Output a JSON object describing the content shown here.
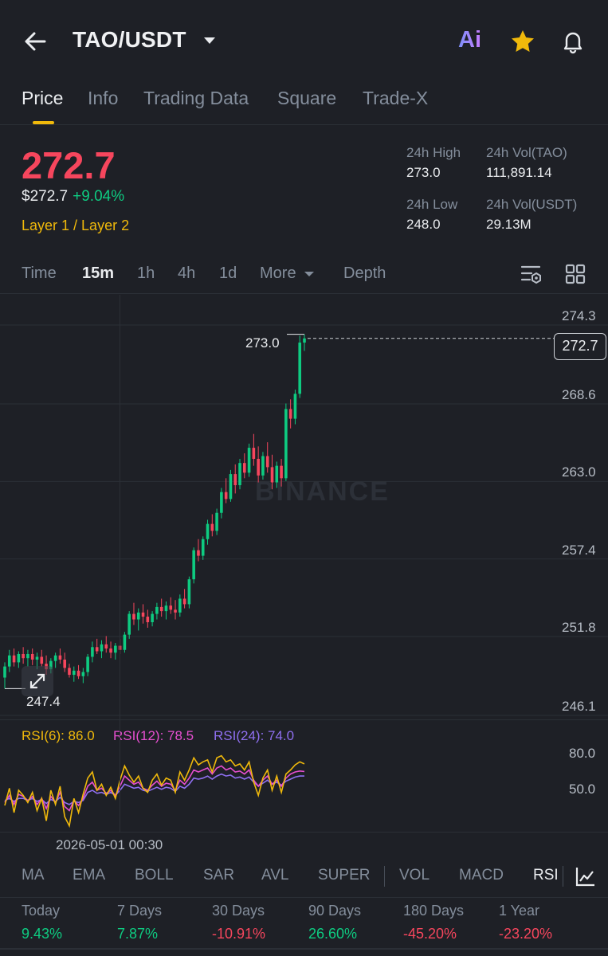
{
  "header": {
    "pair": "TAO/USDT",
    "ai_label": "Ai"
  },
  "tabs": [
    "Price",
    "Info",
    "Trading Data",
    "Square",
    "Trade-X"
  ],
  "price": {
    "last": "272.7",
    "usd": "$272.7",
    "change": "+9.04%",
    "tag": "Layer 1 / Layer 2"
  },
  "stats": {
    "high_label": "24h High",
    "high": "273.0",
    "vol_tao_label": "24h Vol(TAO)",
    "vol_tao": "111,891.14",
    "low_label": "24h Low",
    "low": "248.0",
    "vol_usdt_label": "24h Vol(USDT)",
    "vol_usdt": "29.13M"
  },
  "timeframes": {
    "time": "Time",
    "m15": "15m",
    "h1": "1h",
    "h4": "4h",
    "d1": "1d",
    "more": "More",
    "depth": "Depth"
  },
  "chart": {
    "watermark": "BINANCE",
    "price_axis": [
      "274.3",
      "268.6",
      "263.0",
      "257.4",
      "251.8",
      "246.1"
    ],
    "current_price_label": "272.7",
    "high_marker": "273.0",
    "low_marker": "247.4",
    "time_label": "2026-05-01 00:30",
    "colors": {
      "up": "#0ecb81",
      "down": "#f6465d"
    }
  },
  "rsi": {
    "rsi6": "RSI(6): 86.0",
    "rsi12": "RSI(12): 78.5",
    "rsi24": "RSI(24): 74.0",
    "axis": [
      "80.0",
      "50.0"
    ],
    "colors": {
      "rsi6": "#f0b90b",
      "rsi12": "#e64fd0",
      "rsi24": "#8f6ff0"
    }
  },
  "indicators": [
    "MA",
    "EMA",
    "BOLL",
    "SAR",
    "AVL",
    "SUPER",
    "VOL",
    "MACD",
    "RSI"
  ],
  "performance": [
    {
      "label": "Today",
      "value": "9.43%"
    },
    {
      "label": "7 Days",
      "value": "7.87%"
    },
    {
      "label": "30 Days",
      "value": "-10.91%"
    },
    {
      "label": "90 Days",
      "value": "26.60%"
    },
    {
      "label": "180 Days",
      "value": "-45.20%"
    },
    {
      "label": "1 Year",
      "value": "-23.20%"
    }
  ],
  "chart_data": {
    "type": "candlestick",
    "ylim": [
      246.1,
      274.3
    ],
    "y_ticks": [
      274.3,
      268.6,
      263.0,
      257.4,
      251.8,
      246.1
    ],
    "candles": [
      [
        248.2,
        249.3,
        247.4,
        249.0
      ],
      [
        249.0,
        250.2,
        248.6,
        249.8
      ],
      [
        249.8,
        250.3,
        249.0,
        249.3
      ],
      [
        249.3,
        250.1,
        248.9,
        249.9
      ],
      [
        249.9,
        250.4,
        249.2,
        249.6
      ],
      [
        249.6,
        250.2,
        249.0,
        249.9
      ],
      [
        249.9,
        250.3,
        249.1,
        249.5
      ],
      [
        249.5,
        250.0,
        248.8,
        249.7
      ],
      [
        249.7,
        250.2,
        249.0,
        249.2
      ],
      [
        249.2,
        249.8,
        248.4,
        248.8
      ],
      [
        248.8,
        249.6,
        248.5,
        249.4
      ],
      [
        249.4,
        250.0,
        248.9,
        249.8
      ],
      [
        249.8,
        250.3,
        249.2,
        249.5
      ],
      [
        249.5,
        250.0,
        248.6,
        248.9
      ],
      [
        248.9,
        249.2,
        248.2,
        248.4
      ],
      [
        248.4,
        249.0,
        247.9,
        248.7
      ],
      [
        248.7,
        249.1,
        248.1,
        248.3
      ],
      [
        248.3,
        248.9,
        247.8,
        248.6
      ],
      [
        248.6,
        249.9,
        248.3,
        249.7
      ],
      [
        249.7,
        250.8,
        249.3,
        250.4
      ],
      [
        250.4,
        251.0,
        249.9,
        250.1
      ],
      [
        250.1,
        250.9,
        249.6,
        250.6
      ],
      [
        250.6,
        251.2,
        250.0,
        250.3
      ],
      [
        250.3,
        250.8,
        249.6,
        250.0
      ],
      [
        250.0,
        250.7,
        249.5,
        250.5
      ],
      [
        250.5,
        251.0,
        249.9,
        250.2
      ],
      [
        250.2,
        251.5,
        250.0,
        251.3
      ],
      [
        251.3,
        253.0,
        251.0,
        252.8
      ],
      [
        252.8,
        253.6,
        252.0,
        252.4
      ],
      [
        252.4,
        253.2,
        251.6,
        252.9
      ],
      [
        252.9,
        253.5,
        252.1,
        252.6
      ],
      [
        252.6,
        253.1,
        251.8,
        252.2
      ],
      [
        252.2,
        253.0,
        251.9,
        252.8
      ],
      [
        252.8,
        253.6,
        252.4,
        253.3
      ],
      [
        253.3,
        253.9,
        252.6,
        253.0
      ],
      [
        253.0,
        253.7,
        252.4,
        253.4
      ],
      [
        253.4,
        254.0,
        252.8,
        253.1
      ],
      [
        253.1,
        253.8,
        252.4,
        252.9
      ],
      [
        252.9,
        254.2,
        252.6,
        253.9
      ],
      [
        253.9,
        254.6,
        253.2,
        253.5
      ],
      [
        253.5,
        255.5,
        253.2,
        255.3
      ],
      [
        255.3,
        257.6,
        255.0,
        257.4
      ],
      [
        257.4,
        258.2,
        256.6,
        257.0
      ],
      [
        257.0,
        258.4,
        256.7,
        258.2
      ],
      [
        258.2,
        259.6,
        257.8,
        259.3
      ],
      [
        259.3,
        260.0,
        258.4,
        258.8
      ],
      [
        258.8,
        260.4,
        258.5,
        260.1
      ],
      [
        260.1,
        261.9,
        259.7,
        261.6
      ],
      [
        261.6,
        262.6,
        260.8,
        261.1
      ],
      [
        261.1,
        263.2,
        260.9,
        262.9
      ],
      [
        262.9,
        263.6,
        261.5,
        262.1
      ],
      [
        262.1,
        264.0,
        261.8,
        263.7
      ],
      [
        263.7,
        264.4,
        262.6,
        263.0
      ],
      [
        263.0,
        265.1,
        262.7,
        264.8
      ],
      [
        264.8,
        265.8,
        263.5,
        264.0
      ],
      [
        264.0,
        264.9,
        262.3,
        262.8
      ],
      [
        262.8,
        264.5,
        262.5,
        264.2
      ],
      [
        264.2,
        265.2,
        263.0,
        263.4
      ],
      [
        263.4,
        264.3,
        261.8,
        262.3
      ],
      [
        262.3,
        263.8,
        261.9,
        263.5
      ],
      [
        263.5,
        264.0,
        262.0,
        262.6
      ],
      [
        262.6,
        268.0,
        262.4,
        267.6
      ],
      [
        267.6,
        268.3,
        266.2,
        266.9
      ],
      [
        266.9,
        269.0,
        266.5,
        268.7
      ],
      [
        268.7,
        272.9,
        268.4,
        272.4
      ],
      [
        272.4,
        273.0,
        271.8,
        272.7
      ]
    ],
    "rsi": {
      "rsi6": [
        45,
        62,
        38,
        60,
        55,
        48,
        58,
        40,
        52,
        30,
        60,
        46,
        64,
        34,
        25,
        52,
        38,
        56,
        72,
        78,
        60,
        66,
        55,
        63,
        52,
        70,
        84,
        75,
        68,
        74,
        62,
        58,
        70,
        76,
        65,
        72,
        70,
        58,
        78,
        70,
        80,
        92,
        85,
        88,
        90,
        78,
        92,
        94,
        88,
        90,
        84,
        86,
        80,
        88,
        68,
        55,
        72,
        80,
        60,
        74,
        58,
        76,
        80,
        85,
        88,
        86
      ],
      "rsi12": [
        48,
        55,
        46,
        56,
        54,
        50,
        54,
        46,
        52,
        42,
        54,
        48,
        58,
        44,
        40,
        50,
        45,
        52,
        64,
        68,
        60,
        62,
        57,
        60,
        55,
        64,
        74,
        70,
        66,
        68,
        62,
        60,
        65,
        69,
        64,
        67,
        66,
        60,
        70,
        66,
        72,
        80,
        78,
        80,
        82,
        76,
        82,
        84,
        80,
        82,
        78,
        79,
        76,
        80,
        70,
        64,
        70,
        74,
        66,
        70,
        64,
        72,
        76,
        78,
        79,
        78.5
      ],
      "rsi24": [
        50,
        52,
        49,
        52,
        52,
        50,
        52,
        49,
        51,
        47,
        51,
        49,
        53,
        48,
        46,
        49,
        48,
        50,
        58,
        60,
        57,
        58,
        56,
        58,
        55,
        60,
        66,
        64,
        62,
        63,
        60,
        59,
        61,
        63,
        61,
        63,
        62,
        59,
        64,
        62,
        66,
        72,
        71,
        72,
        74,
        71,
        74,
        76,
        74,
        75,
        72,
        73,
        71,
        73,
        68,
        64,
        67,
        70,
        66,
        68,
        65,
        69,
        71,
        73,
        74,
        74.0
      ]
    }
  }
}
